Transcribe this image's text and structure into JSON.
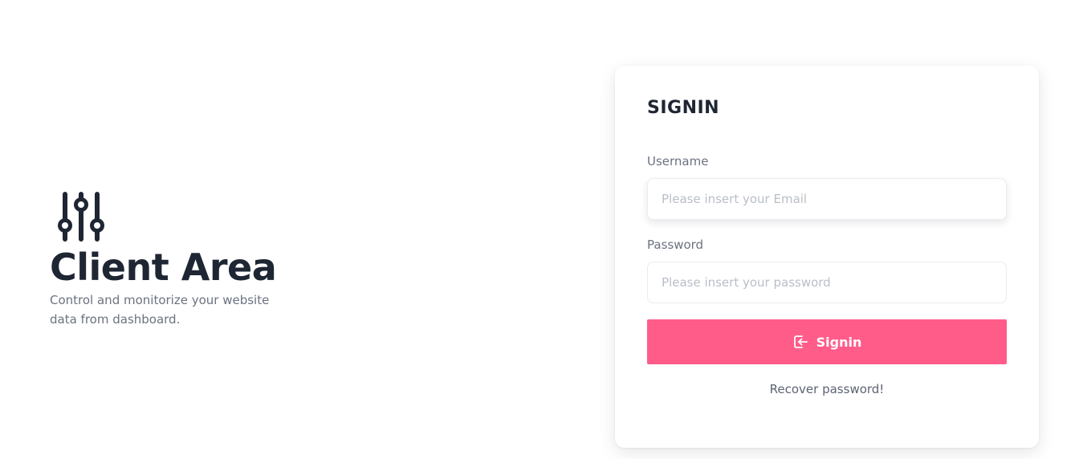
{
  "hero": {
    "icon": "sliders-icon",
    "title": "Client Area",
    "subtitle": "Control and monitorize your website data from dashboard."
  },
  "signin": {
    "title": "SIGNIN",
    "username_label": "Username",
    "username_placeholder": "Please insert your Email",
    "username_value": "",
    "password_label": "Password",
    "password_placeholder": "Please insert your password",
    "password_value": "",
    "button_label": "Signin",
    "button_icon": "login-icon",
    "recover_label": "Recover password!"
  },
  "colors": {
    "accent": "#ff5c8a",
    "heading": "#1f2633",
    "muted": "#6b7280"
  }
}
